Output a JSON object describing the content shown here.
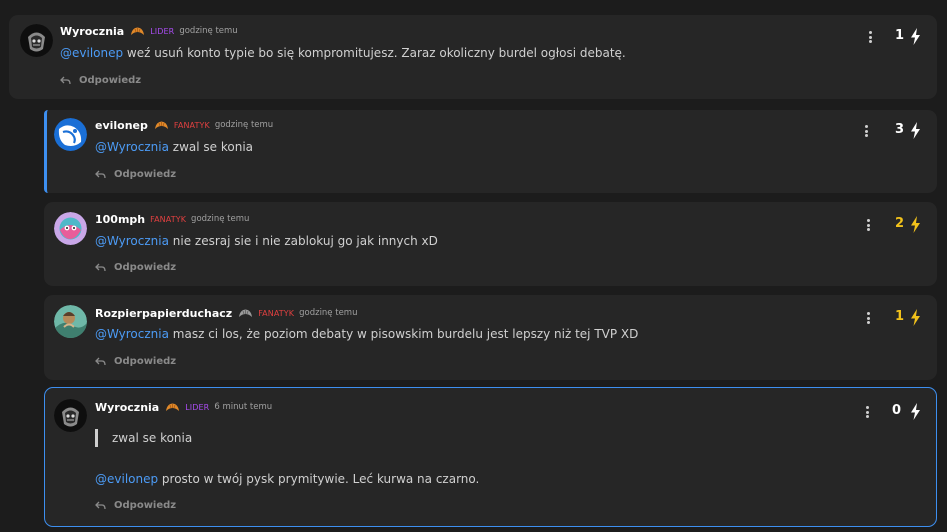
{
  "reply_label": "Odpowiedz",
  "colors": {
    "accent": "#3d8ff0",
    "mention": "#4c9bf5",
    "lider": "#a84cf0",
    "fanatyk": "#e04040",
    "score_gold": "#f2c21b"
  },
  "icons": {
    "menu": "kebab-menu-icon",
    "vote": "lightning-bolt-icon",
    "reply": "reply-arrow-icon",
    "badge": "croissant-icon"
  },
  "comments": [
    {
      "user": "Wyrocznia",
      "rank": "LIDER",
      "time": "godzinę temu",
      "mention": "@evilonep",
      "text": " weź usuń konto typie bo się kompromitujesz. Zaraz okoliczny burdel ogłosi debatę.",
      "score": "1"
    },
    {
      "user": "evilonep",
      "rank": "FANATYK",
      "time": "godzinę temu",
      "mention": "@Wyrocznia",
      "text": " zwal se konia",
      "score": "3"
    },
    {
      "user": "100mph",
      "rank": "FANATYK",
      "time": "godzinę temu",
      "mention": "@Wyrocznia",
      "text": " nie zesraj sie i nie zablokuj go jak innych xD",
      "score": "2"
    },
    {
      "user": "Rozpierpapierduchacz",
      "rank": "FANATYK",
      "time": "godzinę temu",
      "mention": "@Wyrocznia",
      "text": " masz ci los, że poziom debaty w pisowskim burdelu jest lepszy niż tej TVP XD",
      "score": "1"
    },
    {
      "user": "Wyrocznia",
      "rank": "LIDER",
      "time": "6 minut temu",
      "quote": "zwal se konia",
      "mention": "@evilonep",
      "text": " prosto w twój pysk prymitywie. Leć kurwa na czarno.",
      "score": "0"
    }
  ]
}
